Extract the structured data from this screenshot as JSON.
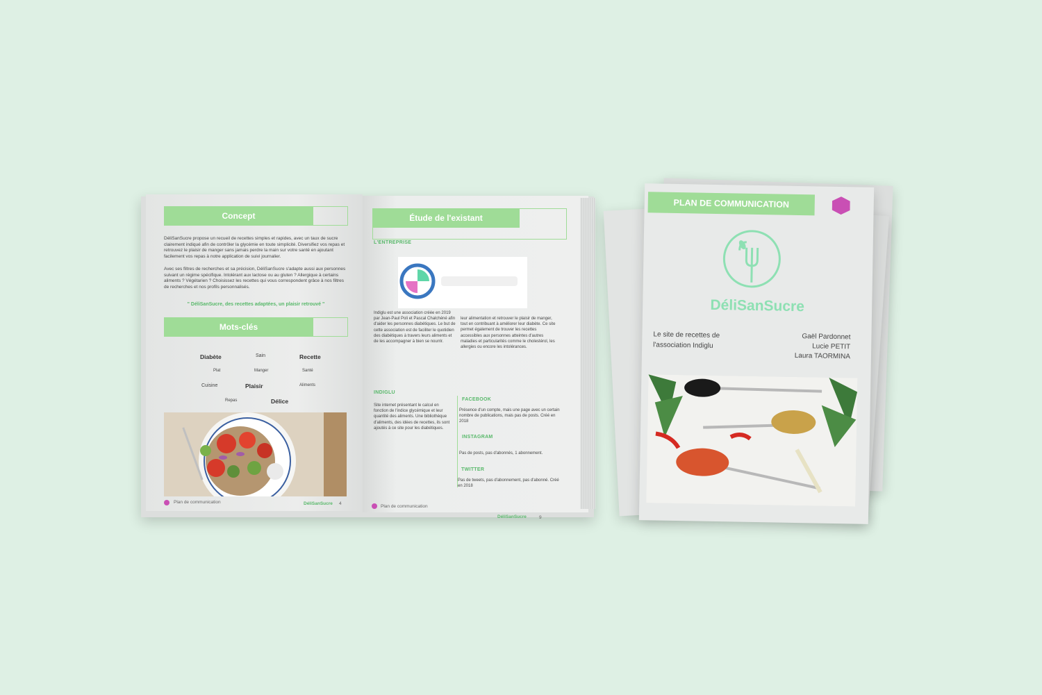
{
  "left_page": {
    "concept_title": "Concept",
    "concept_p1": "DéliSanSucre propose un recueil de recettes simples et rapides, avec un taux de sucre clairement indiqué afin de contrôler la glycémie en toute simplicité. Diversifiez vos repas et retrouvez le plaisir de manger sans jamais perdre la main sur votre santé en ajoutant facilement vos repas à notre application de suivi journalier.",
    "concept_p2": "Avec ses filtres de recherches et sa précision, DéliSanSucre s'adapte aussi aux personnes suivant un régime spécifique. Intolérant aux lactose ou au gluten ? Allergique à certains aliments ? Végétarien ? Choisissez les recettes qui vous correspondent grâce à nos filtres de recherches et nos profils personnalisés.",
    "quote": "\" DéliSanSucre, des recettes adaptées, un plaisir retrouvé \"",
    "keywords_title": "Mots-clés",
    "keywords": [
      "Diabète",
      "Sain",
      "Recette",
      "Plat",
      "Manger",
      "Santé",
      "Cuisine",
      "Plaisir",
      "Aliments",
      "Repas",
      "Délice"
    ],
    "footer_left": "Plan de communication",
    "footer_brand": "DéliSanSucre",
    "page_num": "4"
  },
  "right_page": {
    "title": "Étude de l'existant",
    "section_company": "L'ENTREPRISE",
    "company_text": "Indiglu est une association créée en 2019 par Jean-Paul Poli et Pascal Chalchéné afin d'aider les personnes diabétiques. Le but de cette association est de faciliter le quotidien des diabétiques à travers leurs aliments et de les accompagner à bien se nourrir.",
    "company_text2": "leur alimentation et retrouver le plaisir de manger, tout en contribuant à améliorer leur diabète. Ce site permet également de trouver les recettes accessibles aux personnes atteintes d'autres maladies et particularités comme le cholestérol, les allergies ou encore les intolérances.",
    "section_indiglu": "INDIGLU",
    "indiglu_text": "Site internet présentant le calcul en fonction de l'indice glycémique et leur quantité des aliments. Une bibliothèque d'aliments, des idées de recettes, ils sont ajoutés à ce site pour les diabétiques.",
    "section_facebook": "FACEBOOK",
    "facebook_text": "Présence d'un compte, mais une page avec un certain nombre de publications, mais pas de posts. Créé en 2018",
    "section_instagram": "INSTAGRAM",
    "instagram_text": "Pas de posts, pas d'abonnés, 1 abonnement.",
    "section_twitter": "TWITTER",
    "twitter_text": "Pas de tweets, pas d'abonnement, pas d'abonné. Créé en 2018",
    "footer_left": "Plan de communication",
    "footer_brand": "DéliSanSucre",
    "page_num": "9"
  },
  "cover": {
    "header": "PLAN DE COMMUNICATION",
    "brand": "DéliSanSucre",
    "subtitle_line1": "Le site de recettes de",
    "subtitle_line2": "l'association Indiglu",
    "author1": "Gaël Pardonnet",
    "author2": "Lucie PETIT",
    "author3": "Laura TAORMINA"
  },
  "colors": {
    "background": "#def0e4",
    "green": "#9fdc97",
    "green_text": "#58b86a",
    "magenta": "#c94fb4",
    "paper": "#e9ebea"
  }
}
